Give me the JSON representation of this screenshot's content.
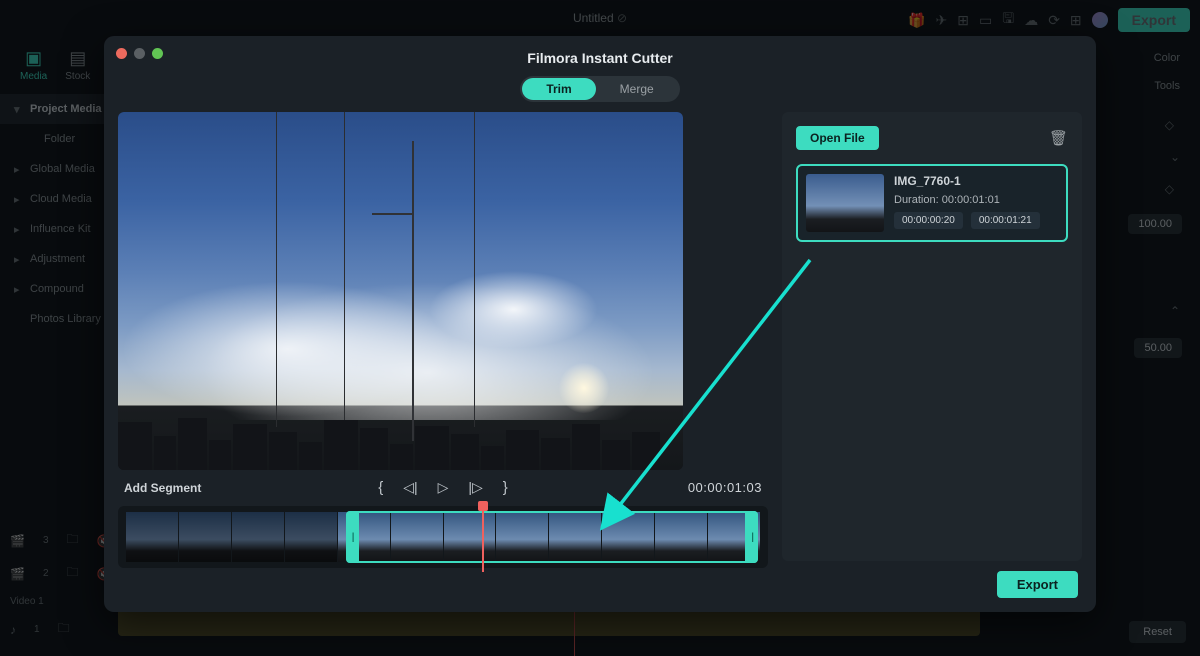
{
  "app": {
    "title": "Untitled",
    "export_label": "Export",
    "top_icon_glyphs": [
      "🎁",
      "✈",
      "⊞",
      "▭",
      "▥",
      "☁",
      "⟳",
      "⊞",
      "•"
    ]
  },
  "left_panel": {
    "tabs": [
      {
        "label": "Media",
        "icon": "▣",
        "active": true
      },
      {
        "label": "Stock",
        "icon": "▤",
        "active": false
      }
    ],
    "items": [
      {
        "label": "Project Media",
        "selected": true
      },
      {
        "label": "Folder",
        "indent": true
      },
      {
        "label": "Global Media"
      },
      {
        "label": "Cloud Media"
      },
      {
        "label": "Influence Kit"
      },
      {
        "label": "Adjustment"
      },
      {
        "label": "Compound"
      },
      {
        "label": "Photos Library",
        "nochev": true
      }
    ]
  },
  "right_panel": {
    "top_labels": [
      "Color",
      "Tools"
    ],
    "value1": "100.00",
    "value2": "50.00",
    "reset": "Reset"
  },
  "bottom_tracks": [
    "3",
    "2",
    "Video 1",
    "1"
  ],
  "modal": {
    "title": "Filmora Instant Cutter",
    "tabs": {
      "trim": "Trim",
      "merge": "Merge"
    },
    "add_segment": "Add Segment",
    "timecode": "00:00:01:03",
    "open_file": "Open File",
    "export": "Export",
    "clip": {
      "name": "IMG_7760-1",
      "duration_label": "Duration:",
      "duration": "00:00:01:01",
      "in": "00:00:00:20",
      "out": "00:00:01:21"
    }
  }
}
